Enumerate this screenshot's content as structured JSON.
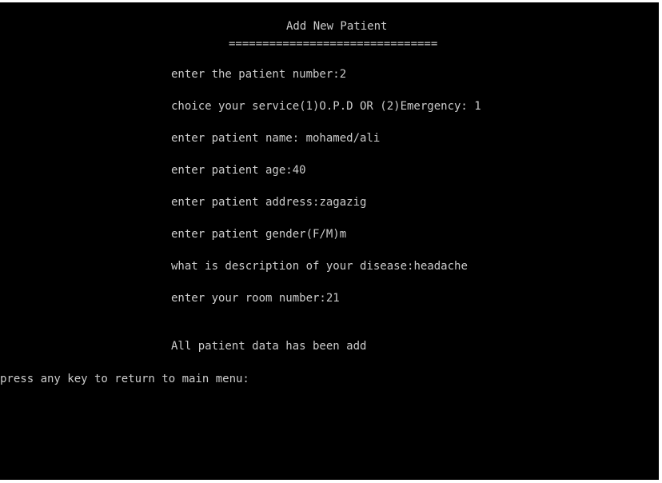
{
  "screen": {
    "title": "Add New Patient",
    "underline": "==============================="
  },
  "prompts": [
    {
      "label": "enter the patient number:",
      "value": "2"
    },
    {
      "label": "choice your service(1)O.P.D OR (2)Emergency: ",
      "value": "1"
    },
    {
      "label": "enter patient name: ",
      "value": "mohamed/ali"
    },
    {
      "label": "enter patient age:",
      "value": "40"
    },
    {
      "label": "enter patient address:",
      "value": "zagazig"
    },
    {
      "label": "enter patient gender(F/M)",
      "value": "m"
    },
    {
      "label": "what is description of your disease:",
      "value": "headache"
    },
    {
      "label": "enter your room number:",
      "value": "21"
    }
  ],
  "status": {
    "message": "All patient data has been add"
  },
  "footer": {
    "text": "press any key to return to main menu:"
  },
  "colors": {
    "background": "#000000",
    "text": "#cccccc"
  }
}
